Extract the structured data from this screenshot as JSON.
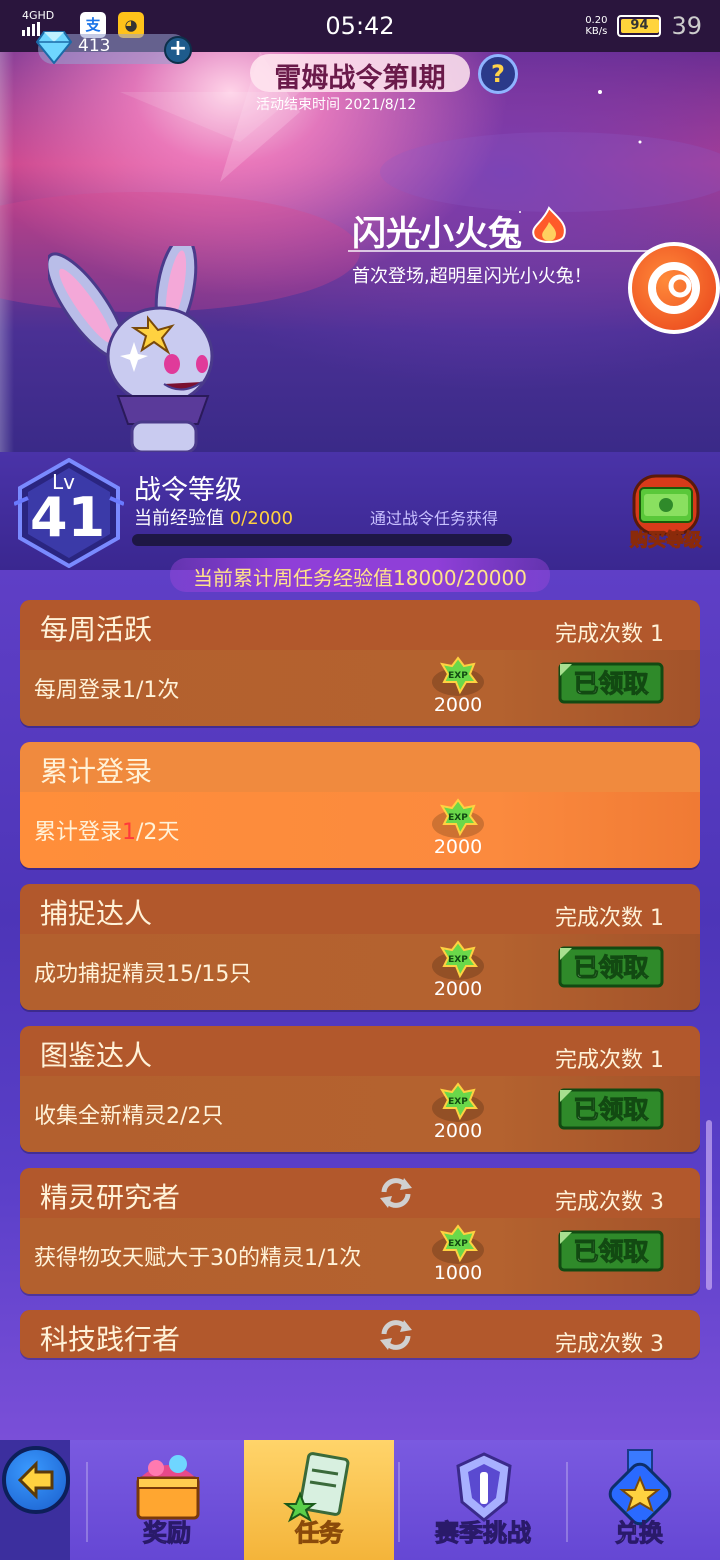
{
  "status_bar": {
    "network": "4GHD",
    "time": "05:42",
    "speed": "0.20",
    "speed_unit": "KB/s",
    "battery": "94",
    "battery_extra": "39"
  },
  "banner": {
    "gems": "413",
    "season_title": "雷姆战令第l期",
    "season_end": "活动结束时间 2021/8/12",
    "help": "?",
    "hero_name": "闪光小火兔",
    "hero_desc": "首次登场,超明星闪光小火兔！"
  },
  "level": {
    "lv_label": "Lv",
    "lv_num": "41",
    "title": "战令等级",
    "exp_label": "当前经验值 ",
    "exp_value": "0/2000",
    "exp_progress": 0,
    "hint": "通过战令任务获得",
    "buy_label": "购买等级",
    "weekly": "当前累计周任务经验值18000/20000"
  },
  "tasks": [
    {
      "title": "每周活跃",
      "count": "完成次数 1",
      "desc": "每周登录1/1次",
      "exp": "2000",
      "status": "已领取"
    },
    {
      "title": "累计登录",
      "desc_a": "累计登录",
      "desc_b": "1",
      "desc_c": "/2天",
      "exp": "2000"
    },
    {
      "title": "捕捉达人",
      "count": "完成次数 1",
      "desc": "成功捕捉精灵15/15只",
      "exp": "2000",
      "status": "已领取"
    },
    {
      "title": "图鉴达人",
      "count": "完成次数 1",
      "desc": "收集全新精灵2/2只",
      "exp": "2000",
      "status": "已领取"
    },
    {
      "title": "精灵研究者",
      "count": "完成次数 3",
      "desc": "获得物攻天赋大于30的精灵1/1次",
      "exp": "1000",
      "status": "已领取"
    },
    {
      "title": "科技践行者",
      "count": "完成次数 3"
    }
  ],
  "exp_icon_text": "EXP",
  "nav": {
    "rewards": "奖励",
    "tasks": "任务",
    "season": "赛季挑战",
    "exchange": "兑换"
  },
  "colors": {
    "accent_gold": "#ffd040",
    "task_card": "#b2582c",
    "task_active": "#f08a3e",
    "claimed_green": "#2f8a2a"
  }
}
